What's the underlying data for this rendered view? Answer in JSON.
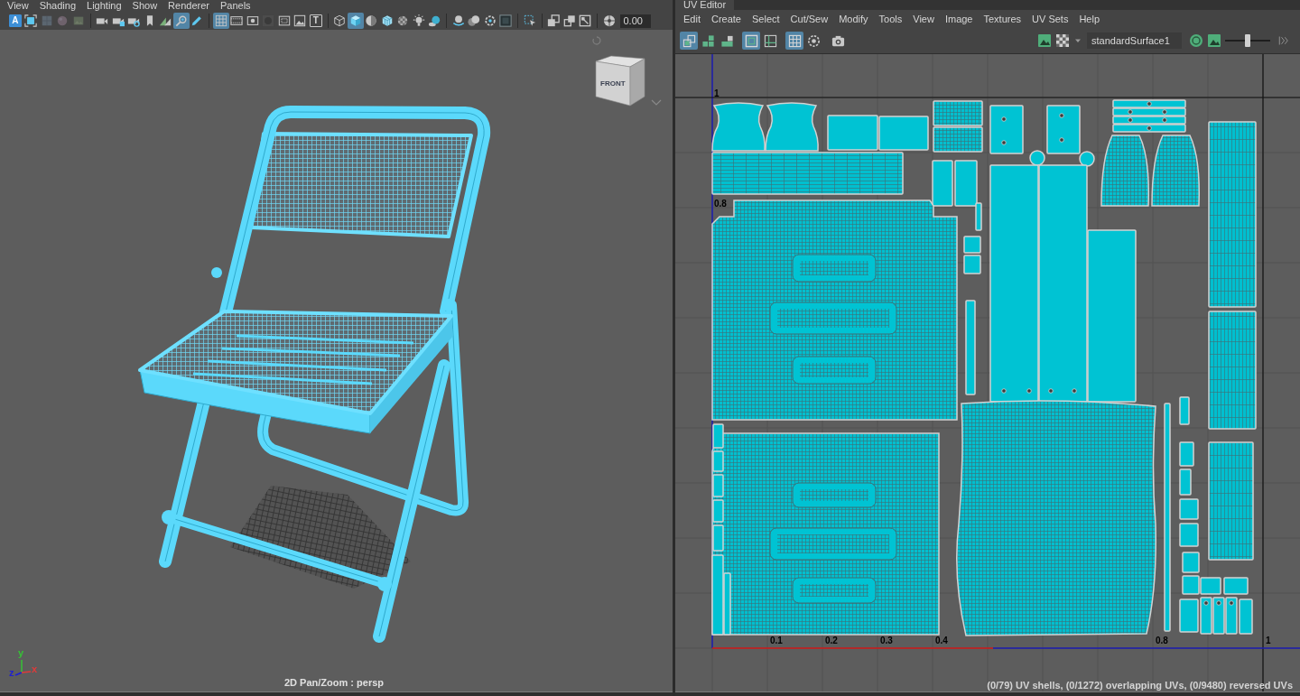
{
  "viewport_panel": {
    "menu": [
      "View",
      "Shading",
      "Lighting",
      "Show",
      "Renderer",
      "Panels"
    ],
    "toolbar": [
      [
        {
          "kind": "letter",
          "label": "A",
          "selected": true
        },
        {
          "kind": "icon",
          "selected": false
        },
        {
          "kind": "icon",
          "selected": false
        },
        {
          "kind": "icon",
          "selected": false
        },
        {
          "kind": "icon",
          "selected": false
        }
      ],
      [
        {
          "kind": "icon",
          "selected": false
        },
        {
          "kind": "icon",
          "selected": false
        },
        {
          "kind": "icon",
          "selected": false
        },
        {
          "kind": "icon",
          "selected": false
        },
        {
          "kind": "icon",
          "selected": false
        },
        {
          "kind": "icon",
          "selected": true
        },
        {
          "kind": "icon",
          "selected": false
        }
      ],
      [
        {
          "kind": "icon",
          "selected": true
        },
        {
          "kind": "icon",
          "selected": false
        },
        {
          "kind": "icon",
          "selected": false
        },
        {
          "kind": "icon",
          "selected": false
        },
        {
          "kind": "icon",
          "selected": false
        },
        {
          "kind": "icon",
          "selected": false
        },
        {
          "kind": "letter",
          "label": "T",
          "selected": false
        }
      ],
      [
        {
          "kind": "icon",
          "selected": false
        },
        {
          "kind": "icon",
          "selected": true
        },
        {
          "kind": "icon",
          "selected": false
        },
        {
          "kind": "icon",
          "selected": false
        },
        {
          "kind": "icon",
          "selected": false
        },
        {
          "kind": "icon",
          "selected": false
        },
        {
          "kind": "icon",
          "selected": false
        }
      ],
      [
        {
          "kind": "icon",
          "selected": false
        },
        {
          "kind": "icon",
          "selected": false
        },
        {
          "kind": "icon",
          "selected": false
        },
        {
          "kind": "icon",
          "selected": false
        }
      ],
      [
        {
          "kind": "icon",
          "selected": false
        }
      ],
      [
        {
          "kind": "icon",
          "selected": false
        },
        {
          "kind": "icon",
          "selected": false
        },
        {
          "kind": "icon",
          "selected": false
        }
      ],
      [
        {
          "kind": "icon",
          "selected": false
        }
      ]
    ],
    "exposure_value": "0.00",
    "view_cube_label": "FRONT",
    "axis_labels": [
      {
        "text": "y",
        "color": "#36c236"
      },
      {
        "text": "z",
        "color": "#1e1ed2"
      },
      {
        "text": "x",
        "color": "#e03a3a"
      }
    ],
    "camera_label": "2D Pan/Zoom : persp"
  },
  "uv_editor": {
    "title": "UV Editor",
    "menu": [
      "Edit",
      "Create",
      "Select",
      "Cut/Sew",
      "Modify",
      "Tools",
      "View",
      "Image",
      "Textures",
      "UV Sets",
      "Help"
    ],
    "toolbar": [
      [
        {
          "selected": true
        },
        {
          "selected": false
        },
        {
          "selected": false
        }
      ],
      [
        {
          "selected": true
        },
        {
          "selected": false
        }
      ],
      [
        {
          "selected": true
        },
        {
          "selected": false
        }
      ],
      [
        {
          "selected": false
        }
      ]
    ],
    "material": "standardSurface1",
    "texture_slider": {
      "level": 0.5
    },
    "v_labels": [
      "1",
      "0.8"
    ],
    "u_labels": [
      "0.1",
      "0.2",
      "0.3",
      "0.4",
      "0.8",
      "1"
    ],
    "status": "(0/79) UV shells, (0/1272) overlapping UVs, (0/9480) reversed UVs"
  }
}
